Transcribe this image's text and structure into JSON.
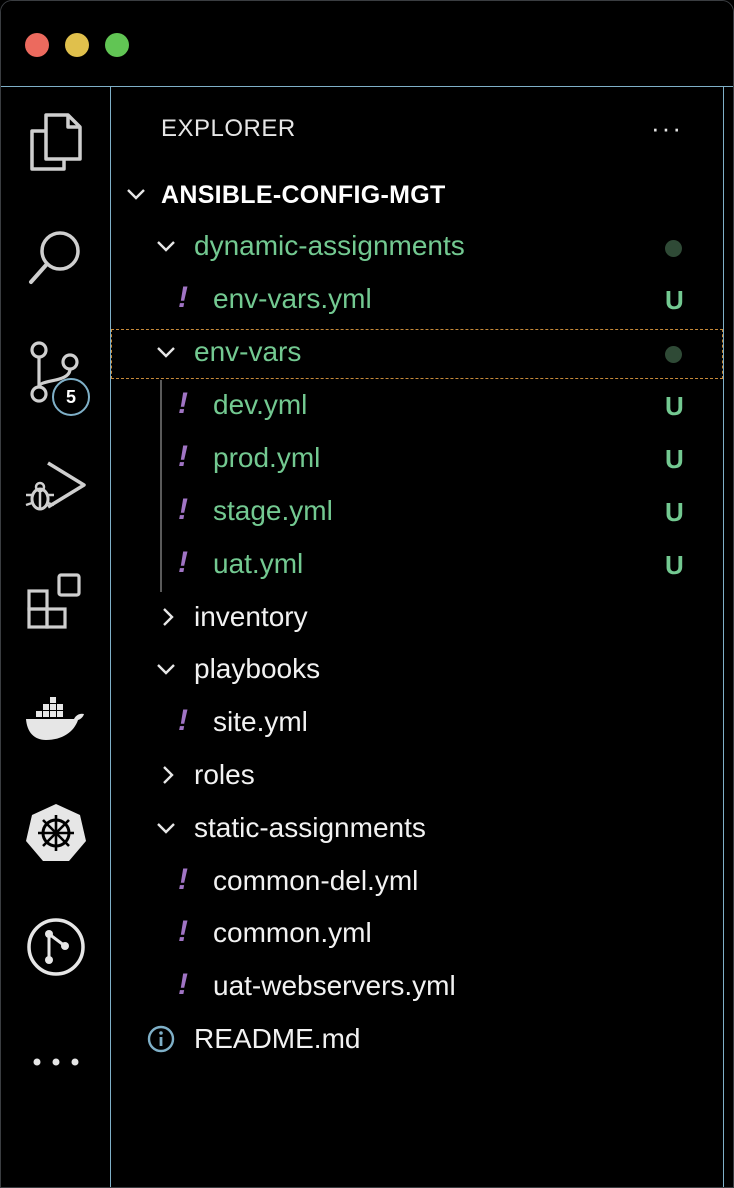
{
  "window": {
    "traffic_lights": {
      "close": "#ec6a5e",
      "minimize": "#e0c04c",
      "maximize": "#61c554"
    }
  },
  "activity_bar": {
    "items": [
      {
        "icon": "explorer-icon"
      },
      {
        "icon": "search-icon"
      },
      {
        "icon": "source-control-icon",
        "badge": "5"
      },
      {
        "icon": "run-debug-icon"
      },
      {
        "icon": "extensions-icon"
      },
      {
        "icon": "docker-icon"
      },
      {
        "icon": "kubernetes-icon"
      },
      {
        "icon": "git-graph-icon"
      },
      {
        "icon": "more-icon"
      }
    ]
  },
  "explorer": {
    "title": "EXPLORER",
    "more": "···",
    "root": "ANSIBLE-CONFIG-MGT",
    "tree": [
      {
        "label": "dynamic-assignments",
        "type": "folder",
        "expanded": true,
        "color": "green",
        "status": "dot"
      },
      {
        "label": "env-vars.yml",
        "type": "yaml",
        "color": "green",
        "status": "U"
      },
      {
        "label": "env-vars",
        "type": "folder",
        "expanded": true,
        "color": "green",
        "status": "dot",
        "selected": true
      },
      {
        "label": "dev.yml",
        "type": "yaml",
        "color": "green",
        "status": "U"
      },
      {
        "label": "prod.yml",
        "type": "yaml",
        "color": "green",
        "status": "U"
      },
      {
        "label": "stage.yml",
        "type": "yaml",
        "color": "green",
        "status": "U"
      },
      {
        "label": "uat.yml",
        "type": "yaml",
        "color": "green",
        "status": "U"
      },
      {
        "label": "inventory",
        "type": "folder",
        "expanded": false,
        "color": "white"
      },
      {
        "label": "playbooks",
        "type": "folder",
        "expanded": true,
        "color": "white"
      },
      {
        "label": "site.yml",
        "type": "yaml",
        "color": "white"
      },
      {
        "label": "roles",
        "type": "folder",
        "expanded": false,
        "color": "white"
      },
      {
        "label": "static-assignments",
        "type": "folder",
        "expanded": true,
        "color": "white"
      },
      {
        "label": "common-del.yml",
        "type": "yaml",
        "color": "white"
      },
      {
        "label": "common.yml",
        "type": "yaml",
        "color": "white"
      },
      {
        "label": "uat-webservers.yml",
        "type": "yaml",
        "color": "white"
      },
      {
        "label": "README.md",
        "type": "markdown",
        "color": "white"
      }
    ]
  },
  "colors": {
    "accent_border": "#7fb0c8",
    "git_untracked": "#73c991",
    "yaml_icon": "#a074c4",
    "selection_outline": "#c78a3a"
  }
}
